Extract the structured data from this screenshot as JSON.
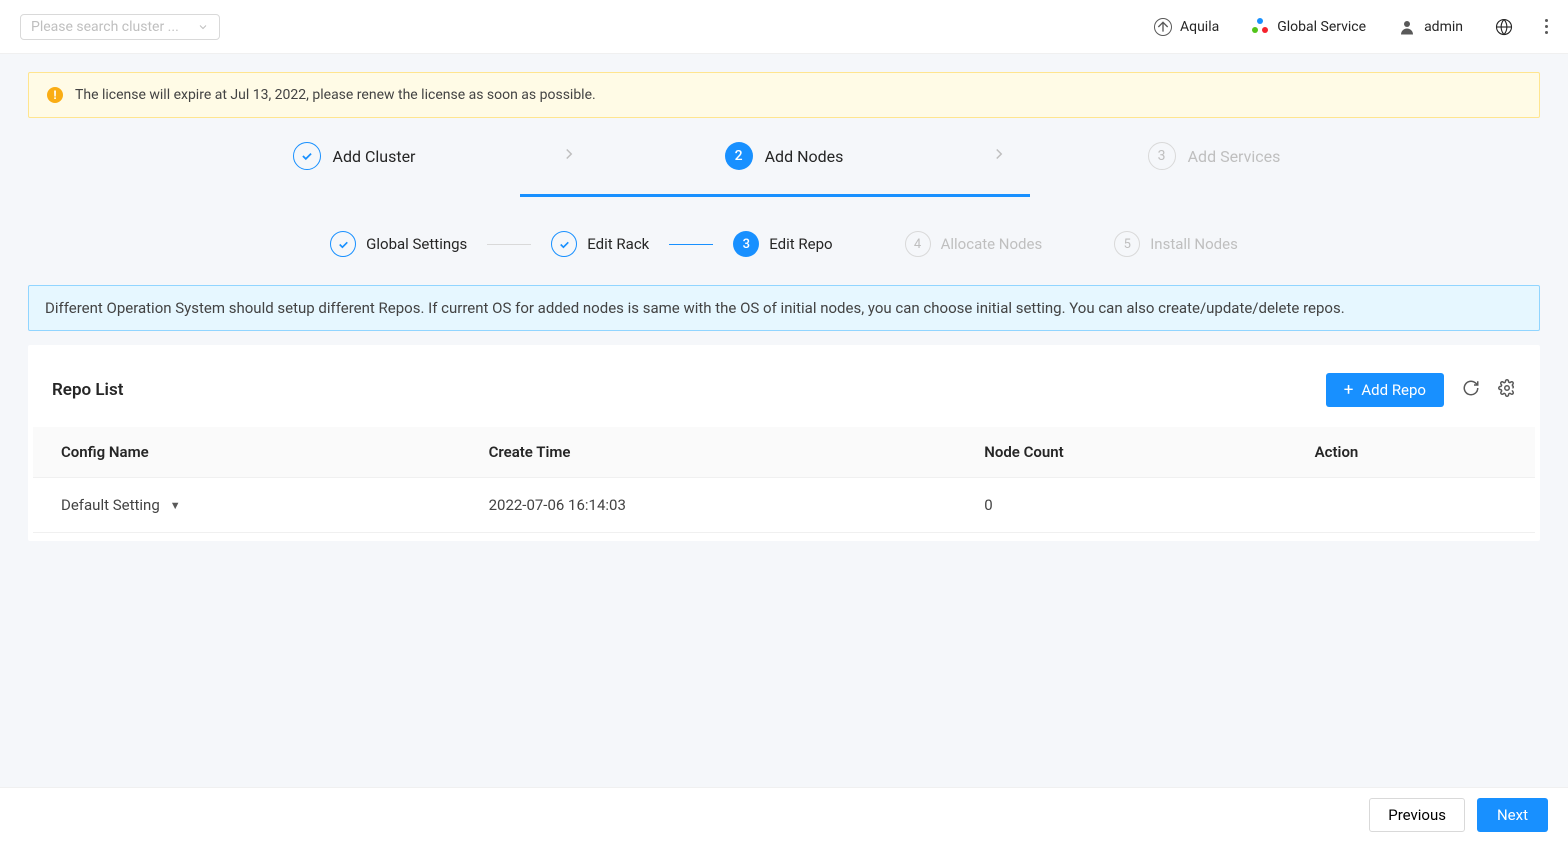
{
  "header": {
    "search_placeholder": "Please search cluster ...",
    "aquila": "Aquila",
    "global_service": "Global Service",
    "admin": "admin"
  },
  "alert": {
    "text": "The license will expire at Jul 13, 2022, please renew the license as soon as possible."
  },
  "main_steps": {
    "s1": "Add Cluster",
    "s2": "Add Nodes",
    "s2_num": "2",
    "s3": "Add Services",
    "s3_num": "3"
  },
  "sub_steps": {
    "s1": "Global Settings",
    "s2": "Edit Rack",
    "s3": "Edit Repo",
    "s3_num": "3",
    "s4": "Allocate Nodes",
    "s4_num": "4",
    "s5": "Install Nodes",
    "s5_num": "5"
  },
  "info_banner": "Different Operation System should setup different Repos. If current OS for added nodes is same with the OS of initial nodes, you can choose initial setting. You can also create/update/delete repos.",
  "card": {
    "title": "Repo List",
    "add_repo": "Add Repo",
    "table": {
      "headers": {
        "config_name": "Config Name",
        "create_time": "Create Time",
        "node_count": "Node Count",
        "action": "Action"
      },
      "rows": [
        {
          "config_name": "Default Setting",
          "create_time": "2022-07-06 16:14:03",
          "node_count": "0"
        }
      ]
    }
  },
  "footer": {
    "previous": "Previous",
    "next": "Next"
  }
}
